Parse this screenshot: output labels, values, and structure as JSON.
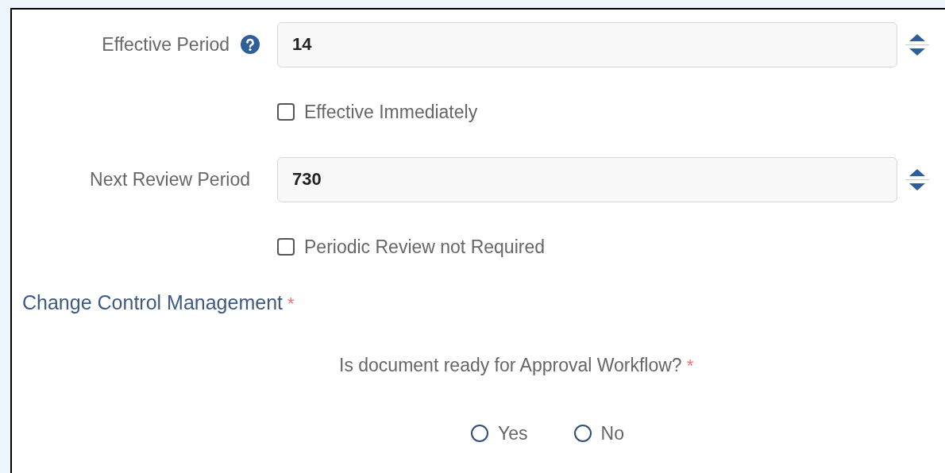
{
  "fields": [
    {
      "label": "Effective Period",
      "help": true,
      "value": "14",
      "checkbox": {
        "label": "Effective Immediately",
        "checked": false
      }
    },
    {
      "label": "Next Review Period",
      "help": false,
      "value": "730",
      "checkbox": {
        "label": "Periodic Review not Required",
        "checked": false
      }
    }
  ],
  "section": {
    "title": "Change Control Management",
    "required_mark": "*"
  },
  "question": {
    "text": "Is document ready for Approval Workflow?",
    "required_mark": "*",
    "options": [
      {
        "label": "Yes",
        "selected": false
      },
      {
        "label": "No",
        "selected": false
      }
    ]
  }
}
